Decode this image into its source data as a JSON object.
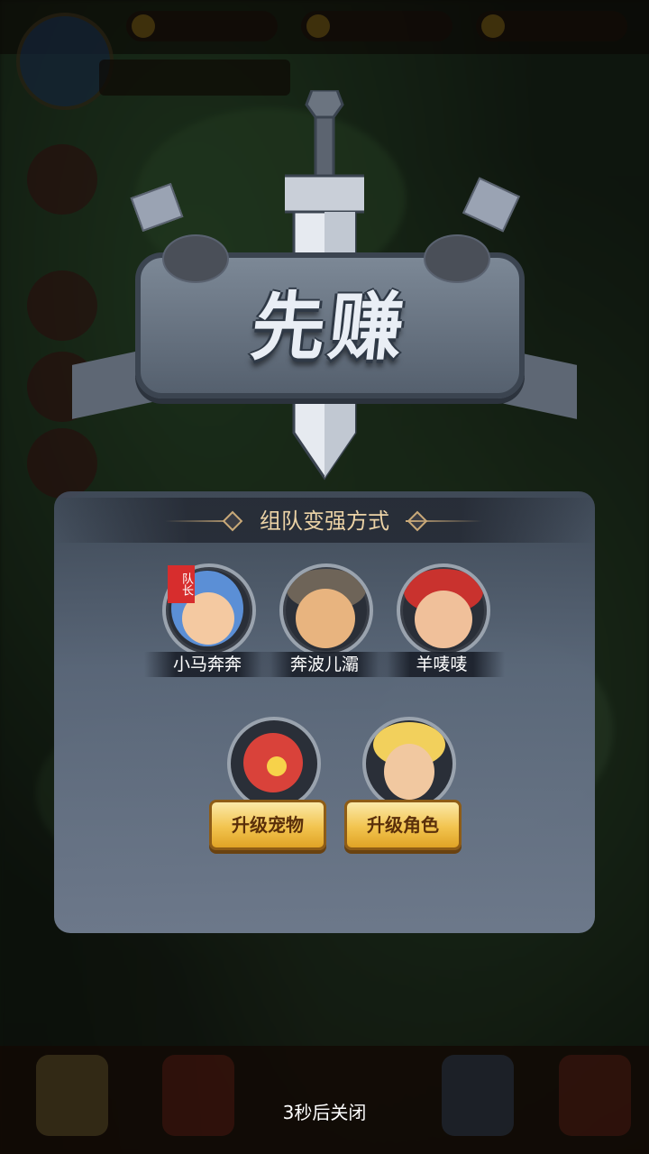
{
  "emblem": {
    "title": "先赚"
  },
  "panel": {
    "section_title": "组队变强方式",
    "team": [
      {
        "name": "小马奔奔",
        "captain_tag": "队长"
      },
      {
        "name": "奔波儿灞"
      },
      {
        "name": "羊唛唛"
      }
    ],
    "upgrades": [
      {
        "label": "升级宠物",
        "icon": "pet-dragon-icon"
      },
      {
        "label": "升级角色",
        "icon": "hero-portrait-icon"
      }
    ]
  },
  "footer": {
    "countdown": "3秒后关闭"
  },
  "colors": {
    "panel": "#6f7b8f",
    "title_text": "#ecd3a6",
    "button": "#f2c44f",
    "captain_tag": "#d72d2d"
  }
}
